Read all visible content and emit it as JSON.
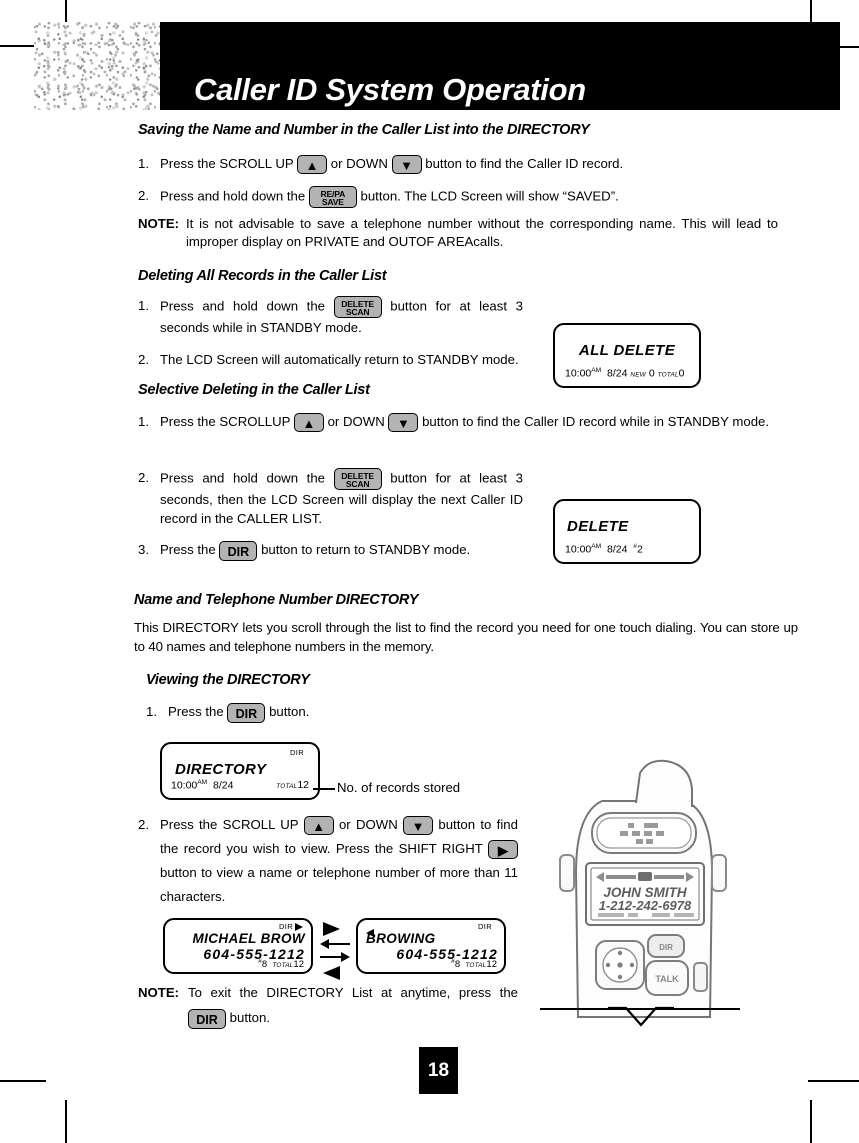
{
  "header": {
    "title": "Caller ID System Operation",
    "logo_icon": "noise-texture-logo"
  },
  "page": {
    "number": "18"
  },
  "sections": [
    {
      "id": "saving",
      "heading": "Saving the Name and Number in the Caller List into the DIRECTORY",
      "steps": [
        {
          "num": "1.",
          "pre": "Press the SCROLL UP",
          "mid": "or DOWN",
          "post": "button to find the Caller ID record."
        },
        {
          "num": "2.",
          "pre": "Press and hold down the",
          "post": "button. The LCD Screen will show “SAVED”."
        }
      ],
      "note_label": "NOTE",
      "note_text": "It is not advisable to save a telephone number without the corresponding name. This will lead to improper display on PRIVATE and OUTOF AREAcalls."
    },
    {
      "id": "delete-all",
      "heading": "Deleting All Records in the Caller List",
      "steps": [
        {
          "num": "1.",
          "pre": "Press and hold down the",
          "post": "button for at least 3 seconds while in STANDBY mode."
        },
        {
          "num": "2.",
          "text": "The LCD Screen will automatically return to STANDBY mode."
        }
      ]
    },
    {
      "id": "selective-delete",
      "heading": "Selective Deleting in the Caller List",
      "steps": [
        {
          "num": "1.",
          "pre": "Press the SCROLLUP",
          "mid": "or DOWN",
          "post": "button to find the Caller ID record while in STANDBY mode."
        },
        {
          "num": "2.",
          "pre": "Press and hold down the",
          "post": "button for at least 3 seconds, then the LCD Screen will display the next Caller ID record in the CALLER LIST."
        },
        {
          "num": "3.",
          "pre": "Press the",
          "post": "button to return to STANDBY mode."
        }
      ]
    },
    {
      "id": "directory",
      "heading": "Name and Telephone Number DIRECTORY",
      "paragraph": "This DIRECTORY lets you scroll through the list to find the record you need for one touch dialing. You can store up to 40 names and telephone numbers in the memory."
    },
    {
      "id": "viewing",
      "heading": "Viewing the DIRECTORY",
      "steps": [
        {
          "num": "1.",
          "pre": "Press the",
          "post": "button."
        },
        {
          "num": "2.",
          "pre": "Press the SCROLL UP",
          "mid": "or DOWN",
          "post2": "button to find the record you wish to view. Press the",
          "mid2": "SHIFT RIGHT",
          "post3": "button to view a name or telephone number of more than 11 characters."
        }
      ],
      "note_label": "NOTE",
      "note_pre": "To exit the DIRECTORY List at anytime, press the",
      "note_post": "button."
    }
  ],
  "buttons": {
    "scroll_up": "▲",
    "scroll_down": "▼",
    "shift_right": "▶",
    "repa_line1": "RE/PA",
    "repa_line2": "SAVE",
    "delete_line1": "DELETE",
    "delete_line2": "SCAN",
    "dir": "DIR"
  },
  "lcds": {
    "all_delete": {
      "title": "ALL DELETE",
      "time": "10:00",
      "ampm": "AM",
      "date": "8/24",
      "new_label": "NEW",
      "new_value": "0",
      "total_label": "TOTAL",
      "total_value": "0"
    },
    "delete": {
      "title": "DELETE",
      "time": "10:00",
      "ampm": "AM",
      "date": "8/24",
      "hash": "#",
      "index": "2"
    },
    "directory": {
      "dir_tag": "DIR",
      "title": "DIRECTORY",
      "time": "10:00",
      "ampm": "AM",
      "date": "8/24",
      "total_label": "TOTAL",
      "total_value": "12",
      "callout": "No. of records stored"
    },
    "record_left": {
      "dir_tag": "DIR",
      "right_arrow_icon": "right-arrow-indicator",
      "name": "MICHAEL BROW",
      "number": "604-555-1212",
      "hash": "#",
      "index": "8",
      "total_label": "TOTAL",
      "total_value": "12"
    },
    "record_right": {
      "dir_tag": "DIR",
      "left_arrow_icon": "left-arrow-indicator",
      "name": "BROWING",
      "number": "604-555-1212",
      "hash": "#",
      "index": "8",
      "total_label": "TOTAL",
      "total_value": "12"
    }
  },
  "phone_illustration": {
    "display_name": "JOHN SMITH",
    "display_number": "1-212-242-6978",
    "keypad_icon": "navigation-pad-icon",
    "button_top": "DIR",
    "button_bottom": "TALK"
  },
  "colors": {
    "banner_bg": "#000000",
    "banner_text": "#ffffff",
    "key_face": "#b3b3b3",
    "page_bg": "#ffffff"
  }
}
